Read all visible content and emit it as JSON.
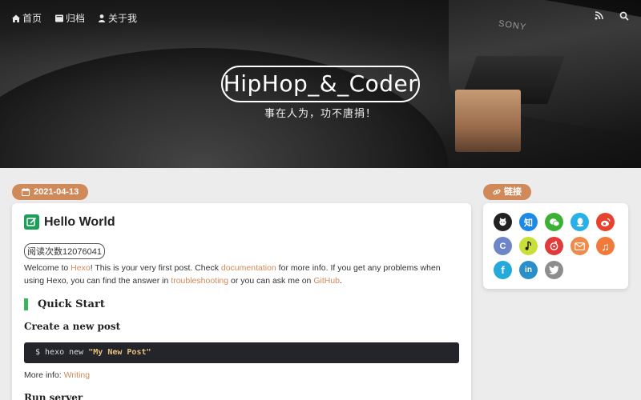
{
  "nav": {
    "home": "首页",
    "archive": "归档",
    "about": "关于我",
    "home_icon": "home-icon",
    "archive_icon": "archive-icon",
    "about_icon": "user-icon",
    "rss_icon": "rss-icon",
    "search_icon": "search-icon"
  },
  "hero": {
    "title": "HipHop_&_Coder",
    "subtitle": "事在人为，功不唐捐！",
    "brand_text": "SONY"
  },
  "post": {
    "date": "2021-04-13",
    "title": "Hello World",
    "views": "阅读次数12076041",
    "intro_1": "Welcome to ",
    "link_hexo": "Hexo",
    "intro_2": "! This is your very first post. Check ",
    "link_docs": "documentation",
    "intro_3": " for more info. If you get any problems when using Hexo, you can find the answer in ",
    "link_trouble": "troubleshooting",
    "intro_4": " or you can ask me on ",
    "link_github": "GitHub",
    "intro_5": ".",
    "quick_start": "Quick Start",
    "create_post": "Create a new post",
    "code_prefix": "$ hexo new ",
    "code_arg": "\"My New Post\"",
    "more_info_label": "More info: ",
    "more_info_link": "Writing",
    "run_server": "Run server"
  },
  "sidebar": {
    "links_label": "链接",
    "socials": [
      {
        "name": "github-icon",
        "glyph": "",
        "color": "#222222"
      },
      {
        "name": "zhihu-icon",
        "glyph": "知",
        "color": "#1e88e5"
      },
      {
        "name": "wechat-icon",
        "glyph": "",
        "color": "#3cb034"
      },
      {
        "name": "qq-icon",
        "glyph": "",
        "color": "#2ab0e8"
      },
      {
        "name": "weibo-icon",
        "glyph": "",
        "color": "#e6432f"
      },
      {
        "name": "coding-icon",
        "glyph": "C",
        "color": "#6e86c8"
      },
      {
        "name": "music-note-icon",
        "glyph": "",
        "color": "#c9e03a"
      },
      {
        "name": "netease-music-icon",
        "glyph": "",
        "color": "#e03a3a"
      },
      {
        "name": "email-icon",
        "glyph": "",
        "color": "#ee8a4a"
      },
      {
        "name": "music-icon",
        "glyph": "♫",
        "color": "#f07a3a"
      },
      {
        "name": "facebook-icon",
        "glyph": "f",
        "color": "#24a9d8"
      },
      {
        "name": "linkedin-icon",
        "glyph": "in",
        "color": "#2a8ec8"
      },
      {
        "name": "twitter-icon",
        "glyph": "",
        "color": "#8d8d8d"
      }
    ]
  }
}
